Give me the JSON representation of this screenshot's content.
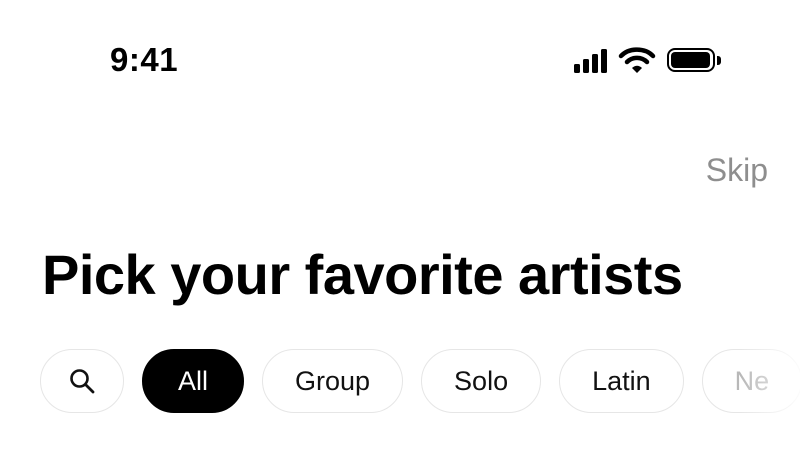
{
  "status_bar": {
    "time": "9:41",
    "icons": [
      "cellular-signal-icon",
      "wifi-icon",
      "battery-icon"
    ],
    "battery_level": 1.0
  },
  "header": {
    "skip_label": "Skip"
  },
  "main": {
    "title": "Pick your favorite artists"
  },
  "filters": {
    "search_icon": "search-icon",
    "selected": "All",
    "chips": [
      {
        "label": "All"
      },
      {
        "label": "Group"
      },
      {
        "label": "Solo"
      },
      {
        "label": "Latin"
      },
      {
        "label": "Ne"
      }
    ]
  },
  "colors": {
    "background": "#ffffff",
    "text": "#000000",
    "muted": "#8e8e8e",
    "chip_border": "#e6e6e6",
    "active_chip_bg": "#000000",
    "active_chip_text": "#ffffff"
  }
}
